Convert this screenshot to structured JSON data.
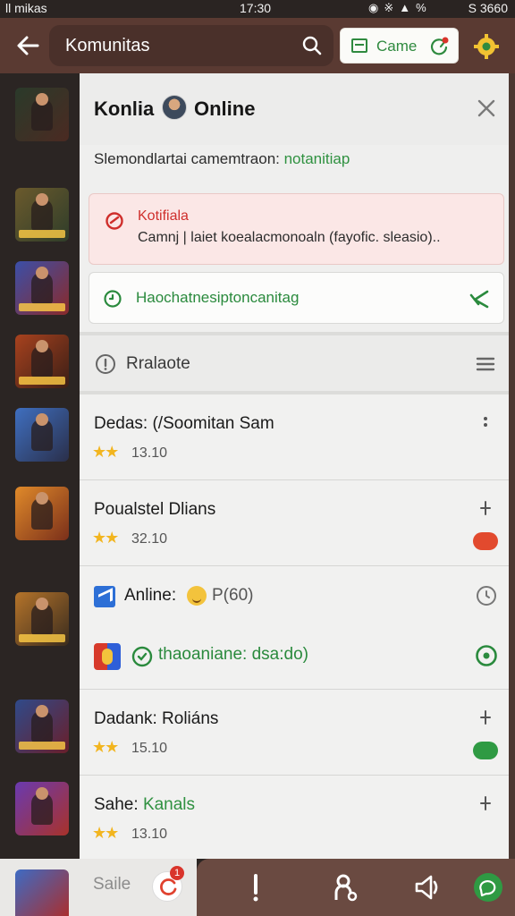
{
  "status_bar": {
    "carrier": "ll mikas",
    "time": "17:30",
    "battery": "S 3660"
  },
  "app_bar": {
    "title": "Komunitas",
    "game_button_label": "Came"
  },
  "panel": {
    "title": "Konlia",
    "title_suffix": "Online",
    "subtitle_prefix": "Slemondlartai camemtraon: ",
    "subtitle_accent": "notanitiap",
    "alert": {
      "title": "Kotifiala",
      "text": "Camnj | laiet koealacmonoaln (fayofic. sleasio).."
    },
    "success": {
      "text": "Haochatnesiptoncanitag"
    },
    "section": {
      "label": "Rralaote"
    },
    "items": [
      {
        "title": "Dedas: (/Soomitan Sam",
        "rating": "13.10"
      },
      {
        "title": "Poualstel Dlians",
        "rating": "32.10",
        "pill_color": "#e24a2e"
      },
      {
        "title": "Dadank: Roliáns",
        "rating": "15.10",
        "pill_color": "#2f9a43"
      },
      {
        "title_prefix": "Sahe: ",
        "title_accent": "Kanals",
        "rating": "13.10"
      }
    ],
    "online": {
      "label": "Anline:",
      "count": "P(60)",
      "status": "thaoaniane: dsa:do)"
    }
  },
  "bottom": {
    "label": "Saile",
    "badge": "1"
  },
  "colors": {
    "app_bar": "#5a3a32",
    "accent_green": "#2f9140",
    "alert_red": "#cf2f2c",
    "star": "#f2b51f"
  },
  "rail_thumbs": [
    {
      "name": "rail-game-1",
      "bg": "linear-gradient(135deg,#2a3a2a,#4b2a22)"
    },
    {
      "name": "rail-game-2",
      "bg": "linear-gradient(135deg,#6b5a2c,#2f3d2a)"
    },
    {
      "name": "rail-game-3",
      "bg": "linear-gradient(135deg,#3b4fa8,#8a2a2a)"
    },
    {
      "name": "rail-game-4",
      "bg": "linear-gradient(135deg,#a8421e,#3a1e16)"
    },
    {
      "name": "rail-game-5",
      "bg": "linear-gradient(135deg,#3f6fc0,#2a2f4a)"
    },
    {
      "name": "rail-game-6",
      "bg": "linear-gradient(135deg,#e08a2a,#7a2f1a)"
    },
    {
      "name": "rail-game-7",
      "bg": "linear-gradient(135deg,#b5742a,#3a2c1e)"
    },
    {
      "name": "rail-game-8",
      "bg": "linear-gradient(135deg,#2f4a8a,#6a1f2a)"
    },
    {
      "name": "rail-game-9",
      "bg": "linear-gradient(135deg,#6a3ab0,#a8322a)"
    }
  ]
}
